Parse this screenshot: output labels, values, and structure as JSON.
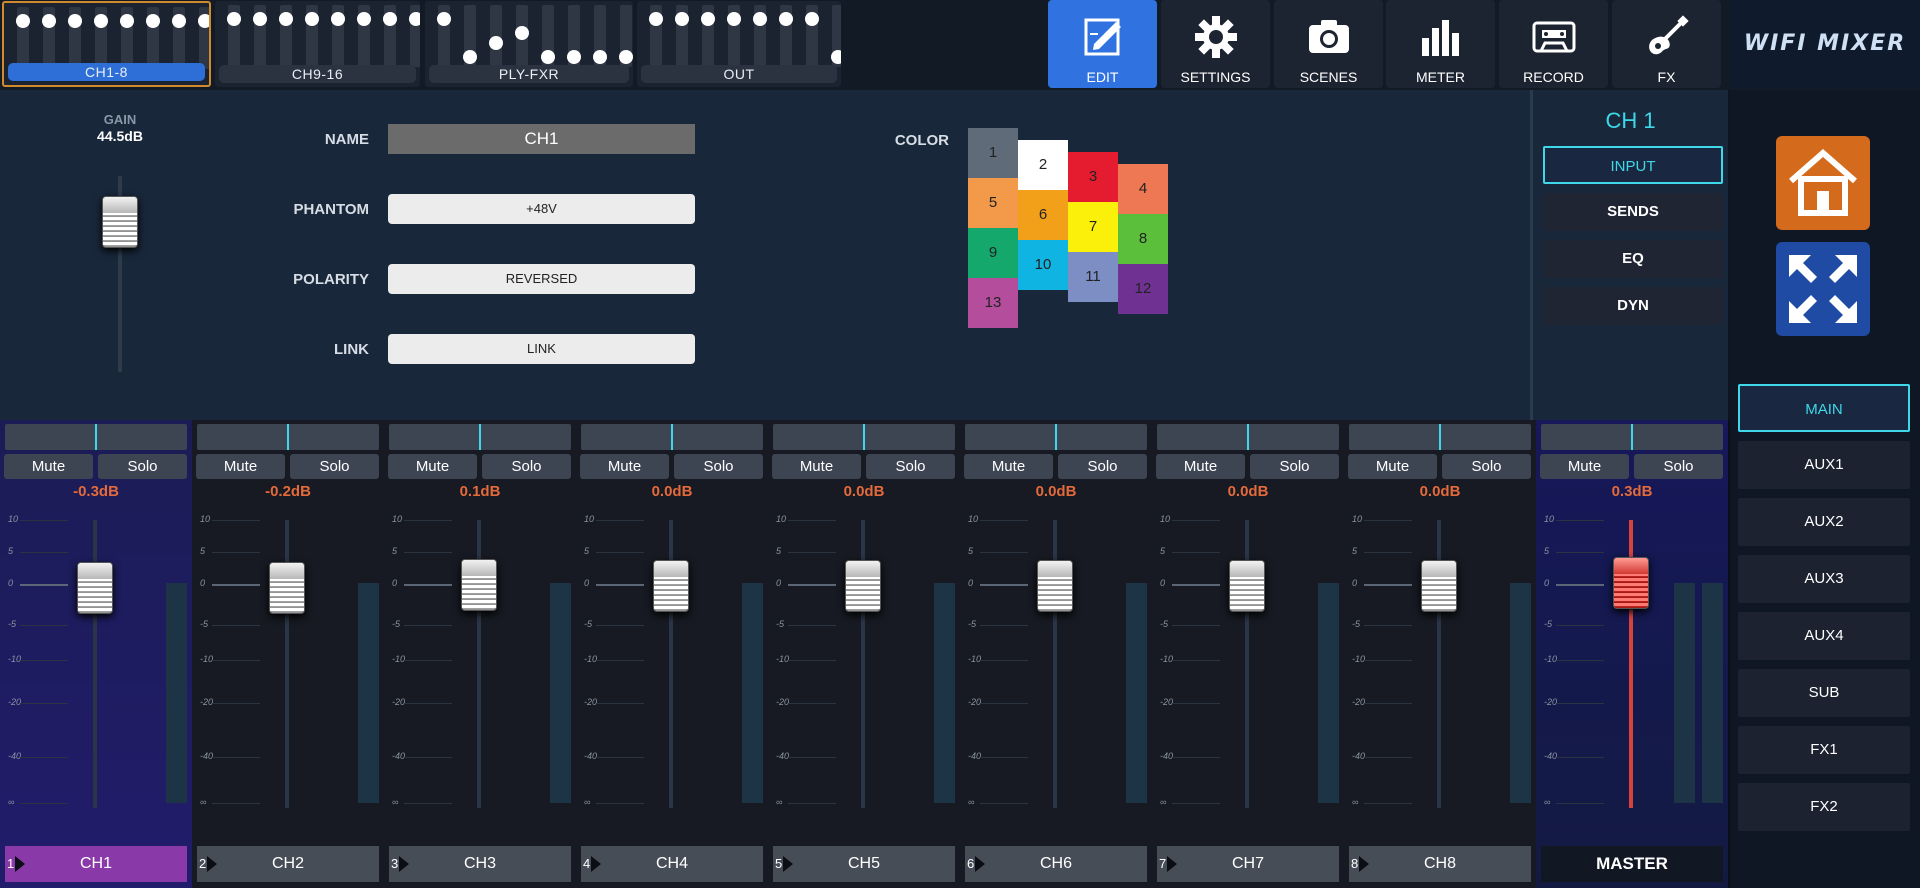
{
  "app": {
    "logo_text": "WIFI MIXER"
  },
  "banks": [
    {
      "label": "CH1-8",
      "selected": true,
      "fader_levels": [
        0.9,
        0.9,
        0.9,
        0.9,
        0.9,
        0.9,
        0.9,
        0.9
      ]
    },
    {
      "label": "CH9-16",
      "selected": false,
      "fader_levels": [
        0.9,
        0.9,
        0.9,
        0.9,
        0.9,
        0.9,
        0.9,
        0.9
      ]
    },
    {
      "label": "PLY-FXR",
      "selected": false,
      "fader_levels": [
        0.9,
        0.1,
        0.4,
        0.6,
        0.1,
        0.1,
        0.1,
        0.1
      ]
    },
    {
      "label": "OUT",
      "selected": false,
      "fader_levels": [
        0.9,
        0.9,
        0.9,
        0.9,
        0.9,
        0.9,
        0.9,
        0.1
      ]
    }
  ],
  "toolbar": [
    {
      "label": "EDIT",
      "icon": "edit-icon",
      "active": true
    },
    {
      "label": "SETTINGS",
      "icon": "gear-icon",
      "active": false
    },
    {
      "label": "SCENES",
      "icon": "camera-icon",
      "active": false
    },
    {
      "label": "METER",
      "icon": "meter-icon",
      "active": false
    },
    {
      "label": "RECORD",
      "icon": "cassette-icon",
      "active": false
    },
    {
      "label": "FX",
      "icon": "guitar-icon",
      "active": false
    }
  ],
  "edit": {
    "gain_label": "GAIN",
    "gain_value": "44.5dB",
    "name_label": "NAME",
    "name_value": "CH1",
    "phantom_label": "PHANTOM",
    "phantom_value": "+48V",
    "polarity_label": "POLARITY",
    "polarity_value": "REVERSED",
    "link_label": "LINK",
    "link_value": "LINK",
    "color_label": "COLOR",
    "colors": [
      {
        "num": "1",
        "hex": "#5f6b78"
      },
      {
        "num": "2",
        "hex": "#ffffff"
      },
      {
        "num": "3",
        "hex": "#e51b2f"
      },
      {
        "num": "4",
        "hex": "#ee7754"
      },
      {
        "num": "5",
        "hex": "#f29a4a"
      },
      {
        "num": "6",
        "hex": "#f2a01a"
      },
      {
        "num": "7",
        "hex": "#fbf00a"
      },
      {
        "num": "8",
        "hex": "#5cbf3b"
      },
      {
        "num": "9",
        "hex": "#15a86c"
      },
      {
        "num": "10",
        "hex": "#10b4e2"
      },
      {
        "num": "11",
        "hex": "#7d8ec4"
      },
      {
        "num": "12",
        "hex": "#6f3292"
      },
      {
        "num": "13",
        "hex": "#b54d9d"
      }
    ]
  },
  "channel_nav": {
    "title": "CH 1",
    "items": [
      {
        "label": "INPUT",
        "active": true
      },
      {
        "label": "SENDS",
        "active": false
      },
      {
        "label": "EQ",
        "active": false
      },
      {
        "label": "DYN",
        "active": false
      }
    ]
  },
  "sidebar": {
    "home_icon": "home-icon",
    "expand_icon": "expand-icon",
    "outputs": [
      {
        "label": "MAIN",
        "active": true
      },
      {
        "label": "AUX1",
        "active": false
      },
      {
        "label": "AUX2",
        "active": false
      },
      {
        "label": "AUX3",
        "active": false
      },
      {
        "label": "AUX4",
        "active": false
      },
      {
        "label": "SUB",
        "active": false
      },
      {
        "label": "FX1",
        "active": false
      },
      {
        "label": "FX2",
        "active": false
      }
    ]
  },
  "scale_labels": [
    "10",
    "5",
    "0",
    "-5",
    "-10",
    "-20",
    "-40",
    "∞"
  ],
  "mute_label": "Mute",
  "solo_label": "Solo",
  "strips": [
    {
      "num": "1",
      "name": "CH1",
      "db": "-0.3dB",
      "selected": true
    },
    {
      "num": "2",
      "name": "CH2",
      "db": "-0.2dB",
      "selected": false
    },
    {
      "num": "3",
      "name": "CH3",
      "db": "0.1dB",
      "selected": false
    },
    {
      "num": "4",
      "name": "CH4",
      "db": "0.0dB",
      "selected": false
    },
    {
      "num": "5",
      "name": "CH5",
      "db": "0.0dB",
      "selected": false
    },
    {
      "num": "6",
      "name": "CH6",
      "db": "0.0dB",
      "selected": false
    },
    {
      "num": "7",
      "name": "CH7",
      "db": "0.0dB",
      "selected": false
    },
    {
      "num": "8",
      "name": "CH8",
      "db": "0.0dB",
      "selected": false
    }
  ],
  "master": {
    "name": "MASTER",
    "db": "0.3dB"
  }
}
